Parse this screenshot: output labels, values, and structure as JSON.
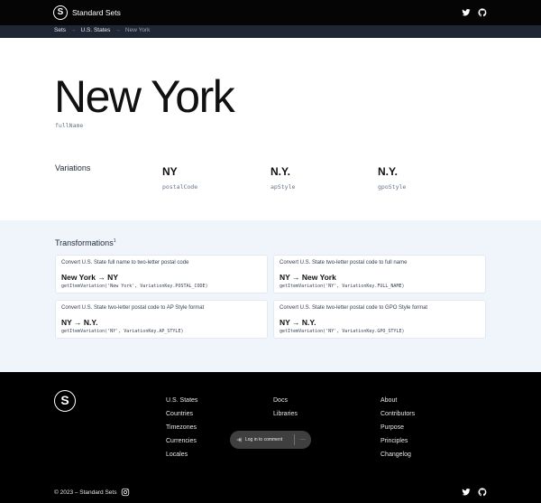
{
  "header": {
    "brand_letter": "S",
    "brand_name": "Standard Sets",
    "icons": [
      "twitter-icon",
      "github-icon"
    ]
  },
  "breadcrumb": {
    "items": [
      "Sets",
      "U.S. States"
    ],
    "separator": "→",
    "current": "New York"
  },
  "hero": {
    "title": "New York",
    "title_key": "fullName"
  },
  "variations": {
    "label": "Variations",
    "items": [
      {
        "value": "NY",
        "key": "postalCode"
      },
      {
        "value": "N.Y.",
        "key": "apStyle"
      },
      {
        "value": "N.Y.",
        "key": "gpoStyle"
      }
    ]
  },
  "transformations": {
    "title": "Transformations",
    "footnote": "1",
    "cards": [
      {
        "desc": "Convert U.S. State full name to two-letter postal code",
        "result": "New York → NY",
        "code": "getItemVariation('New York', VariationKey.POSTAL_CODE)"
      },
      {
        "desc": "Convert U.S. State two-letter postal code to full name",
        "result": "NY → New York",
        "code": "getItemVariation('NY', VariationKey.FULL_NAME)"
      },
      {
        "desc": "Convert U.S. State two-letter postal code to AP Style format",
        "result": "NY → N.Y.",
        "code": "getItemVariation('NY', VariationKey.AP_STYLE)"
      },
      {
        "desc": "Convert U.S. State two-letter postal code to GPO Style format",
        "result": "NY → N.Y.",
        "code": "getItemVariation('NY', VariationKey.GPO_STYLE)"
      }
    ]
  },
  "footer": {
    "logo_letter": "S",
    "columns": [
      [
        "U.S. States",
        "Countries",
        "Timezones",
        "Currencies",
        "Locales"
      ],
      [
        "Docs",
        "Libraries"
      ],
      [
        "About",
        "Contributors",
        "Purpose",
        "Principles",
        "Changelog"
      ]
    ],
    "copyright": "© 2023 – Standard Sets"
  },
  "comment_pill": {
    "label": "Log in to comment",
    "more": "···"
  },
  "colors": {
    "header_bg": "#050505",
    "breadcrumb_bg": "#1f2734",
    "section_bg": "#f0f5fb",
    "footer_bg": "#000000"
  }
}
